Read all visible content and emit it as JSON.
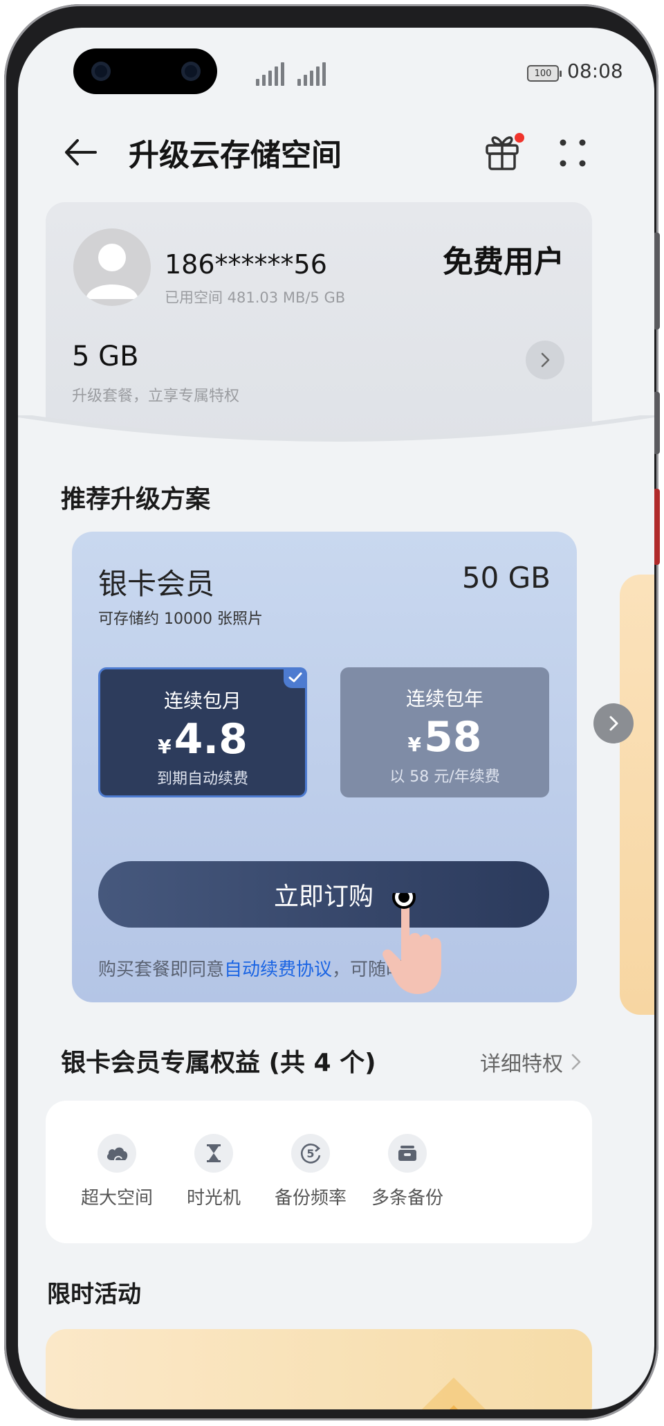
{
  "status_bar": {
    "battery": "100",
    "time": "08:08"
  },
  "header": {
    "title": "升级云存储空间"
  },
  "account": {
    "phone": "186******56",
    "used_space": "已用空间 481.03 MB/5 GB",
    "user_type": "免费用户",
    "quota": "5 GB",
    "quota_hint": "升级套餐，立享专属特权"
  },
  "recommend": {
    "title": "推荐升级方案"
  },
  "plan": {
    "name": "银卡会员",
    "size": "50 GB",
    "desc": "可存储约 10000 张照片",
    "options": [
      {
        "label": "连续包月",
        "currency": "¥",
        "price": "4.8",
        "note": "到期自动续费",
        "selected": true
      },
      {
        "label": "连续包年",
        "currency": "¥",
        "price": "58",
        "note": "以 58 元/年续费",
        "selected": false
      }
    ],
    "buy_label": "立即订购",
    "agreement_prefix": "购买套餐即同意",
    "agreement_link": "自动续费协议",
    "agreement_suffix": "，可随时取消"
  },
  "benefits": {
    "title": "银卡会员专属权益 (共 4 个)",
    "detail_link": "详细特权",
    "items": [
      {
        "label": "超大空间",
        "icon": "cloud-icon"
      },
      {
        "label": "时光机",
        "icon": "hourglass-icon"
      },
      {
        "label": "备份频率",
        "icon": "backup-frequency-icon"
      },
      {
        "label": "多条备份",
        "icon": "multi-backup-icon"
      }
    ]
  },
  "promo": {
    "title": "限时活动"
  },
  "colors": {
    "accent_link": "#1a64e3",
    "selected_border": "#4d7bd0",
    "notification_dot": "#f0342c"
  }
}
